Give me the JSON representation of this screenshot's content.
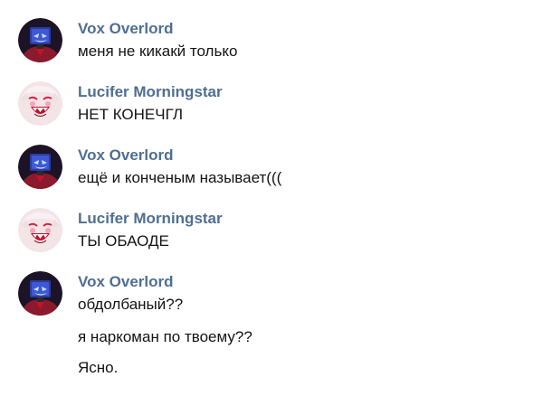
{
  "messages": [
    {
      "author": "Vox Overlord",
      "avatar_icon": "vox-avatar-icon",
      "lines": [
        "меня не кикакй только"
      ]
    },
    {
      "author": "Lucifer Morningstar",
      "avatar_icon": "lucifer-avatar-icon",
      "lines": [
        "НЕТ КОНЕЧГЛ"
      ]
    },
    {
      "author": "Vox Overlord",
      "avatar_icon": "vox-avatar-icon",
      "lines": [
        "ещё и конченым называет((("
      ]
    },
    {
      "author": "Lucifer Morningstar",
      "avatar_icon": "lucifer-avatar-icon",
      "lines": [
        "ТЫ ОБАОДЕ"
      ]
    },
    {
      "author": "Vox Overlord",
      "avatar_icon": "vox-avatar-icon",
      "lines": [
        "обдолбаный??",
        "я наркоман по твоему??",
        "Ясно."
      ]
    }
  ],
  "colors": {
    "author_name": "#4f6f91",
    "message_text": "#141414",
    "background": "#ffffff"
  }
}
